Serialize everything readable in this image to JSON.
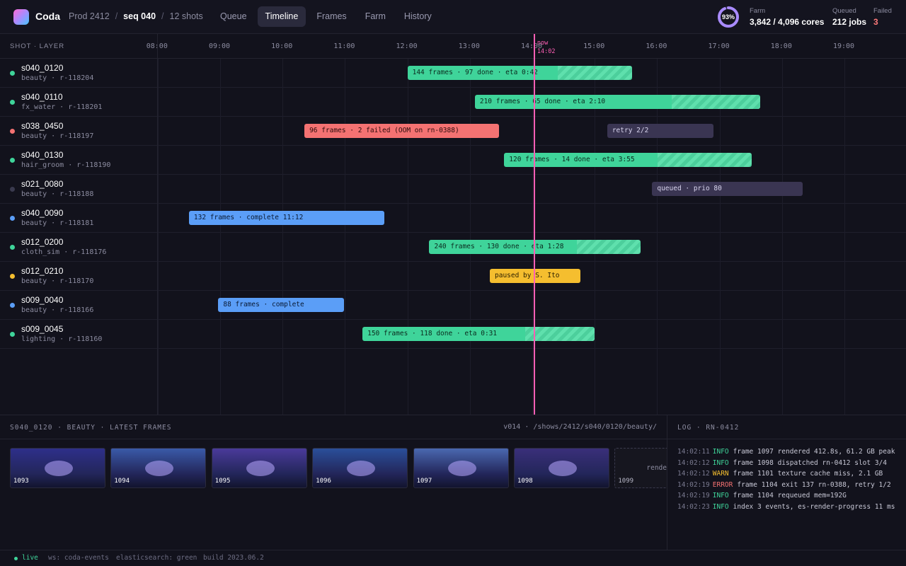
{
  "app": {
    "name": "Coda"
  },
  "breadcrumb": {
    "production": "Prod 2412",
    "sequence": "seq 040",
    "shots": "12 shots"
  },
  "tabs": [
    {
      "label": "Queue",
      "active": false
    },
    {
      "label": "Timeline",
      "active": true
    },
    {
      "label": "Frames",
      "active": false
    },
    {
      "label": "Farm",
      "active": false
    },
    {
      "label": "History",
      "active": false
    }
  ],
  "farm": {
    "utilization_label": "93%",
    "utilization": 0.93,
    "label": "Farm",
    "cores": "3,842 / 4,096 cores",
    "queued_label": "Queued",
    "queued": "212 jobs",
    "failed_label": "Failed",
    "failed": "3"
  },
  "colors": {
    "running": "#3fd49a",
    "failed": "#f47272",
    "queued": "#3a3552",
    "complete": "#5b9ef7",
    "paused": "#f5be2f",
    "idle": "#3a3a4e",
    "now": "#ff5fb5"
  },
  "timeline": {
    "column_header": "SHOT · LAYER",
    "ticks": [
      "08:00",
      "09:00",
      "10:00",
      "11:00",
      "12:00",
      "13:00",
      "14:00",
      "15:00",
      "16:00",
      "17:00",
      "18:00",
      "19:00"
    ],
    "now": {
      "label": "now",
      "time": "14:02",
      "hours": 14.033
    },
    "rows": [
      {
        "shot": "s040_0120",
        "meta": "beauty · r-118204",
        "status": "running",
        "bars": [
          {
            "start": 12.0,
            "end": 15.6,
            "progress": 0.67,
            "label": "144 frames · 97 done · eta 0:42",
            "kind": "running"
          }
        ]
      },
      {
        "shot": "s040_0110",
        "meta": "fx_water · r-118201",
        "status": "running",
        "bars": [
          {
            "start": 13.08,
            "end": 17.65,
            "progress": 0.69,
            "label": "210 frames · 65 done · eta 2:10",
            "kind": "running"
          }
        ]
      },
      {
        "shot": "s038_0450",
        "meta": "beauty · r-118197",
        "status": "failed",
        "bars": [
          {
            "start": 10.35,
            "end": 13.47,
            "progress": 1,
            "label": "96 frames · 2 failed (OOM on rn-0388)",
            "kind": "failed"
          },
          {
            "start": 15.2,
            "end": 16.9,
            "progress": 1,
            "label": "retry 2/2",
            "kind": "queued"
          }
        ]
      },
      {
        "shot": "s040_0130",
        "meta": "hair_groom · r-118190",
        "status": "running",
        "bars": [
          {
            "start": 13.55,
            "end": 17.52,
            "progress": 0.62,
            "label": "120 frames · 14 done · eta 3:55",
            "kind": "running"
          }
        ]
      },
      {
        "shot": "s021_0080",
        "meta": "beauty · r-118188",
        "status": "idle",
        "bars": [
          {
            "start": 15.92,
            "end": 18.33,
            "progress": 1,
            "label": "queued · prio 80",
            "kind": "queued"
          }
        ]
      },
      {
        "shot": "s040_0090",
        "meta": "beauty · r-118181",
        "status": "complete",
        "bars": [
          {
            "start": 8.5,
            "end": 11.63,
            "progress": 1,
            "label": "132 frames · complete 11:12",
            "kind": "complete"
          }
        ]
      },
      {
        "shot": "s012_0200",
        "meta": "cloth_sim · r-118176",
        "status": "running",
        "bars": [
          {
            "start": 12.35,
            "end": 15.73,
            "progress": 0.7,
            "label": "240 frames · 130 done · eta 1:28",
            "kind": "running"
          }
        ]
      },
      {
        "shot": "s012_0210",
        "meta": "beauty · r-118170",
        "status": "paused",
        "bars": [
          {
            "start": 13.32,
            "end": 14.77,
            "progress": 1,
            "label": "paused by S. Ito",
            "kind": "paused"
          }
        ]
      },
      {
        "shot": "s009_0040",
        "meta": "beauty · r-118166",
        "status": "complete",
        "bars": [
          {
            "start": 8.97,
            "end": 10.98,
            "progress": 1,
            "label": "88 frames · complete",
            "kind": "complete"
          }
        ]
      },
      {
        "shot": "s009_0045",
        "meta": "lighting · r-118160",
        "status": "running",
        "bars": [
          {
            "start": 11.28,
            "end": 15.0,
            "progress": 0.7,
            "label": "150 frames · 118 done · eta 0:31",
            "kind": "running"
          }
        ]
      }
    ]
  },
  "frames_panel": {
    "header": "S040_0120 · BEAUTY · LATEST FRAMES",
    "path": "v014 · /shows/2412/s040/0120/beauty/",
    "frames": [
      {
        "number": "1093",
        "state": "rendered",
        "tint": "#2e2f8a"
      },
      {
        "number": "1094",
        "state": "rendered",
        "tint": "#3a5aa8"
      },
      {
        "number": "1095",
        "state": "rendered",
        "tint": "#4a3a9a"
      },
      {
        "number": "1096",
        "state": "rendered",
        "tint": "#2a4f9a"
      },
      {
        "number": "1097",
        "state": "rendered",
        "tint": "#4a68b0"
      },
      {
        "number": "1098",
        "state": "rendered",
        "tint": "#3a2f7a"
      },
      {
        "number": "1099",
        "state": "rendering",
        "pending_text": "render"
      }
    ]
  },
  "log_panel": {
    "header": "LOG · RN-0412",
    "lines": [
      {
        "time": "14:02:11",
        "level": "INFO",
        "message": "frame 1097 rendered 412.8s, 61.2 GB peak"
      },
      {
        "time": "14:02:12",
        "level": "INFO",
        "message": "frame 1098 dispatched rn-0412 slot 3/4"
      },
      {
        "time": "14:02:12",
        "level": "WARN",
        "message": "frame 1101 texture cache miss, 2.1 GB"
      },
      {
        "time": "14:02:19",
        "level": "ERROR",
        "message": "frame 1104 exit 137 rn-0388, retry 1/2"
      },
      {
        "time": "14:02:19",
        "level": "INFO",
        "message": "frame 1104 requeued mem=192G"
      },
      {
        "time": "14:02:23",
        "level": "INFO",
        "message": "index 3 events, es-render-progress 11 ms"
      }
    ],
    "level_colors": {
      "INFO": "#3fd49a",
      "WARN": "#f5be2f",
      "ERROR": "#f47272"
    }
  },
  "statusbar": {
    "live": "live",
    "ws": "ws: coda-events",
    "search": "elasticsearch: green",
    "build": "build 2023.06.2"
  }
}
